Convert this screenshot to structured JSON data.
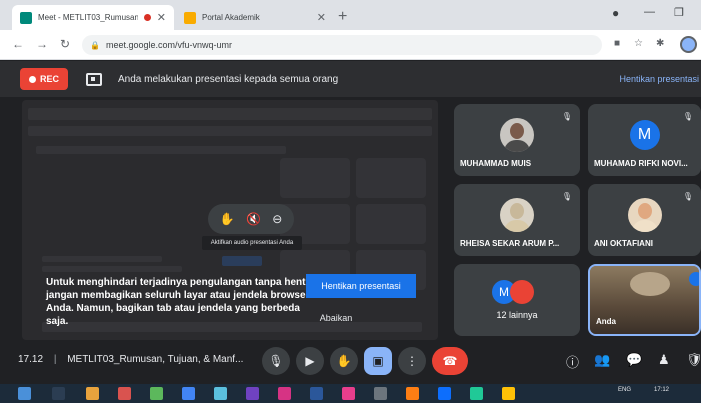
{
  "browser": {
    "tabs": [
      {
        "title": "Meet - METLIT03_Rumusan",
        "active": true,
        "recording": true
      },
      {
        "title": "Portal Akademik",
        "active": false
      }
    ],
    "url": "meet.google.com/vfu-vnwq-umr",
    "colors": {
      "meet_favicon": "#00897b",
      "portal_favicon": "#f9ab00"
    }
  },
  "banner": {
    "rec_label": "REC",
    "message": "Anda melakukan presentasi kepada semua orang",
    "stop_link": "Hentikan presentasi"
  },
  "presentation": {
    "hover_tooltip": "Aktifkan audio presentasi Anda",
    "warning": "Untuk menghindari terjadinya pengulangan tanpa henti, jangan membagikan seluruh layar atau jendela browser Anda. Namun, bagikan tab atau jendela yang berbeda saja.",
    "stop_button": "Hentikan presentasi",
    "ignore_button": "Abaikan"
  },
  "participants": [
    {
      "name": "MUHAMMAD MUIS",
      "avatar": "photo"
    },
    {
      "name": "MUHAMAD RIFKI NOVI...",
      "avatar": "letter",
      "letter": "M"
    },
    {
      "name": "RHEISA SEKAR ARUM P...",
      "avatar": "photo"
    },
    {
      "name": "ANI OKTAFIANI",
      "avatar": "photo"
    }
  ],
  "more_tile": {
    "letter": "M",
    "count_label": "12 lainnya"
  },
  "self_tile": {
    "name": "Anda"
  },
  "controlbar": {
    "time": "17.12",
    "meeting_name": "METLIT03_Rumusan, Tujuan, & Manf..."
  },
  "taskbar": {
    "lang": "ENG",
    "clock": "17:12"
  }
}
